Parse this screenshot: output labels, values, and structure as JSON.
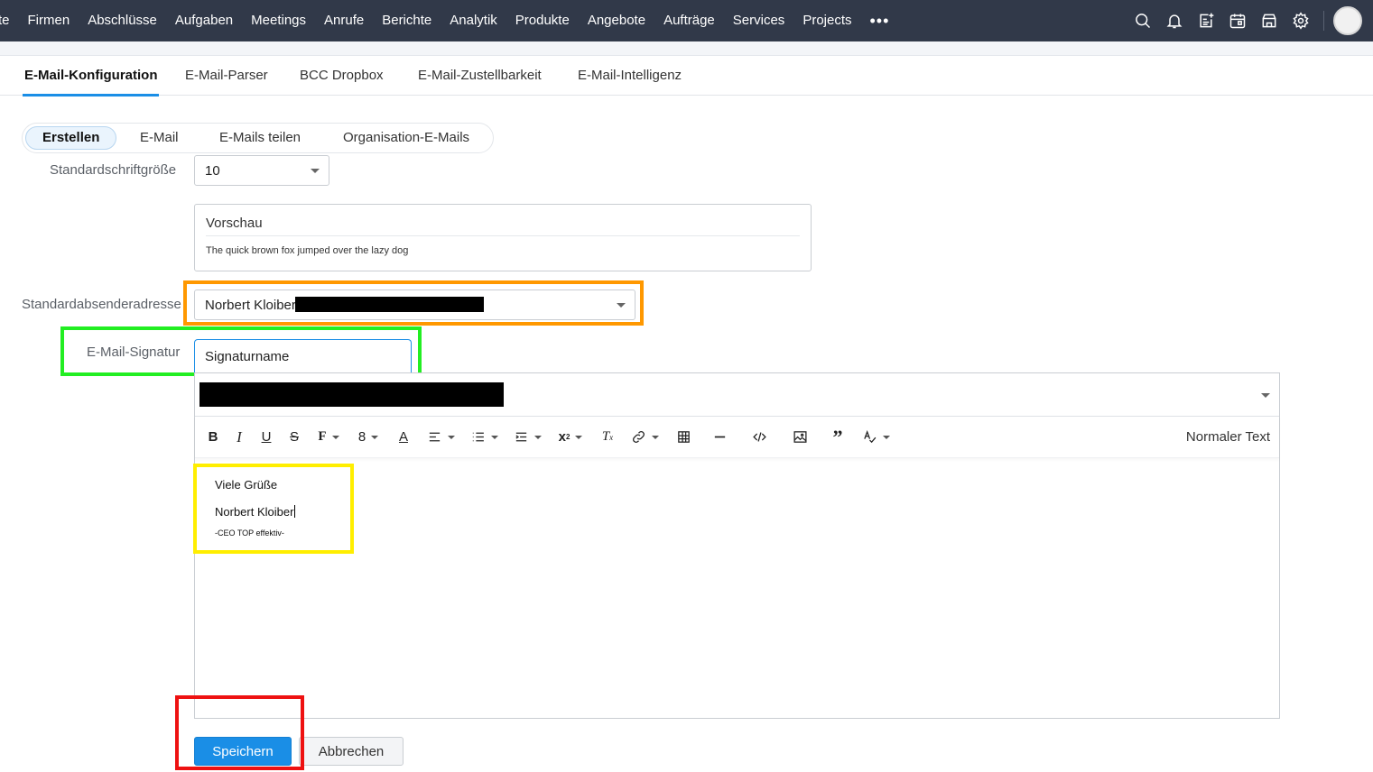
{
  "nav": {
    "items": [
      "te",
      "Firmen",
      "Abschlüsse",
      "Aufgaben",
      "Meetings",
      "Anrufe",
      "Berichte",
      "Analytik",
      "Produkte",
      "Angebote",
      "Aufträge",
      "Services",
      "Projects"
    ],
    "more_label": "•••",
    "icons": [
      "search-icon",
      "bell-icon",
      "add-note-icon",
      "calendar-icon",
      "marketplace-icon",
      "gear-icon"
    ]
  },
  "tabs": [
    "E-Mail-Konfiguration",
    "E-Mail-Parser",
    "BCC Dropbox",
    "E-Mail-Zustellbarkeit",
    "E-Mail-Intelligenz"
  ],
  "pills": [
    "Erstellen",
    "E-Mail",
    "E-Mails teilen",
    "Organisation-E-Mails"
  ],
  "form": {
    "font_size_label": "Standardschriftgröße",
    "font_size_value": "10",
    "preview_title": "Vorschau",
    "preview_text": "The quick brown fox jumped over the lazy dog",
    "sender_label": "Standardabsenderadresse",
    "sender_value": "Norbert Kloiber",
    "signature_label": "E-Mail-Signatur",
    "signature_name": "Signaturname"
  },
  "editor": {
    "toolbar": {
      "font_size": "8",
      "format_label": "Normaler Text"
    },
    "content": {
      "line1": "Viele Grüße",
      "line2": "Norbert Kloiber",
      "line3": "-CEO TOP effektiv-"
    }
  },
  "buttons": {
    "save": "Speichern",
    "cancel": "Abbrechen"
  },
  "colors": {
    "nav_bg": "#313949",
    "accent": "#1a8ee6",
    "highlight_orange": "#ff9800",
    "highlight_green": "#22ee22",
    "highlight_yellow": "#ffee00",
    "highlight_red": "#ee1111"
  }
}
